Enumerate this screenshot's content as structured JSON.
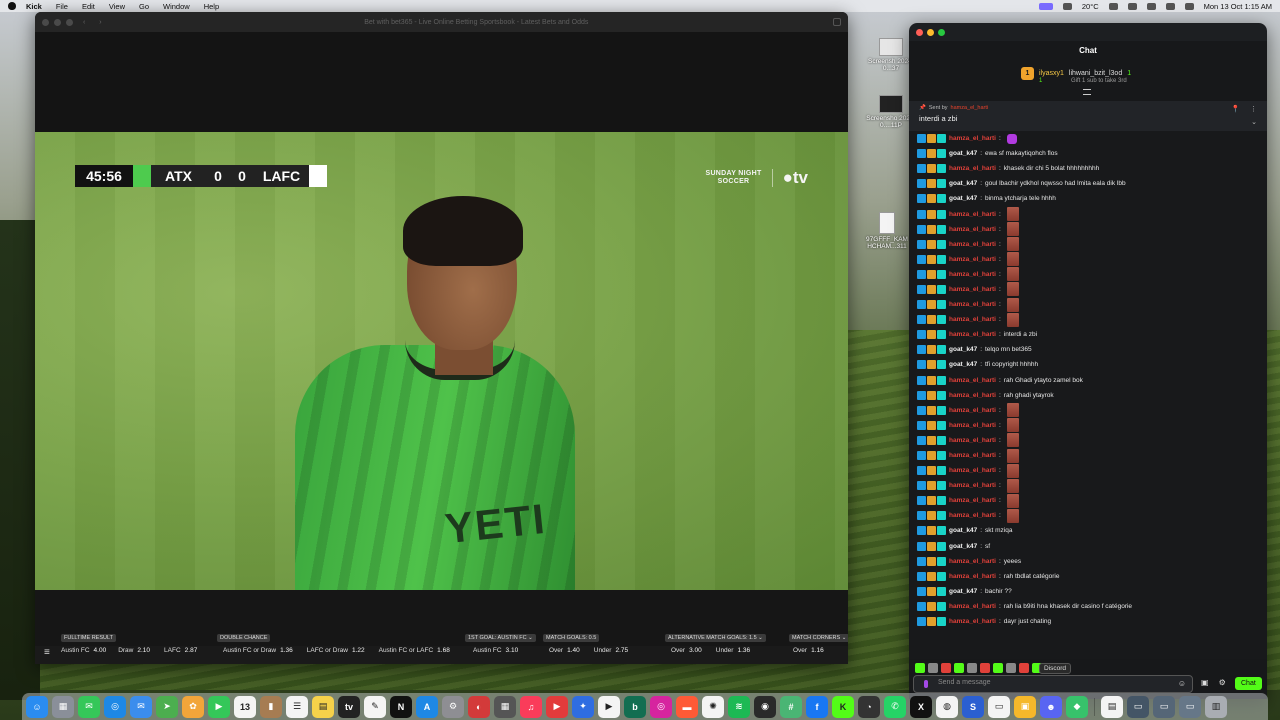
{
  "menubar": {
    "app_name": "Kick",
    "menus": [
      "File",
      "Edit",
      "View",
      "Go",
      "Window",
      "Help"
    ],
    "weather": "20°C",
    "datetime": "Mon 13 Oct 1:15 AM"
  },
  "desktop": {
    "files": [
      {
        "label": "Screensh 2024-0...37"
      },
      {
        "label": "Screensho 2024-0....11P"
      },
      {
        "label": "97GFFF_KAM HCHAM...311"
      }
    ]
  },
  "browser": {
    "title": "Bet with bet365 - Live Online Betting Sportsbook - Latest Bets and Odds",
    "scoreboard": {
      "clock": "45:56",
      "home_team": "ATX",
      "home_score": "0",
      "away_score": "0",
      "away_team": "LAFC"
    },
    "broadcast": {
      "show_line1": "SUNDAY NIGHT",
      "show_line2": "SOCCER",
      "network": "tv"
    },
    "jersey_text": "YETI",
    "bets": [
      {
        "head": "FULLTIME RESULT",
        "items": [
          {
            "label": "Austin FC",
            "odds": "4.00"
          },
          {
            "label": "Draw",
            "odds": "2.10"
          },
          {
            "label": "LAFC",
            "odds": "2.87"
          }
        ]
      },
      {
        "head": "DOUBLE CHANCE",
        "items": [
          {
            "label": "Austin FC or Draw",
            "odds": "1.36"
          },
          {
            "label": "LAFC or Draw",
            "odds": "1.22"
          },
          {
            "label": "Austin FC or LAFC",
            "odds": "1.68"
          }
        ]
      },
      {
        "head": "1ST GOAL: AUSTIN FC ⌄",
        "items": [
          {
            "label": "Austin FC",
            "odds": "3.10"
          }
        ]
      },
      {
        "head": "MATCH GOALS: 0.5",
        "items": [
          {
            "label": "Over",
            "odds": "1.40"
          },
          {
            "label": "Under",
            "odds": "2.75"
          }
        ]
      },
      {
        "head": "ALTERNATIVE MATCH GOALS: 1.5 ⌄",
        "items": [
          {
            "label": "Over",
            "odds": "3.00"
          },
          {
            "label": "Under",
            "odds": "1.36"
          }
        ]
      },
      {
        "head": "MATCH CORNERS ⌄",
        "items": [
          {
            "label": "Over",
            "odds": "1.16"
          }
        ]
      }
    ]
  },
  "chat": {
    "title": "Chat",
    "gift": {
      "badge": "1",
      "user1": "ilyasxy1",
      "count1": "1",
      "user2": "lihwani_bzit_l3od",
      "count2": "1",
      "subtext": "Gift 1 sub to take 3rd"
    },
    "pinned": {
      "sent_by_label": "Sent by",
      "user": "hamza_el_harti",
      "message": "interdi a zbi"
    },
    "messages": [
      {
        "user": "hamza_el_harti",
        "color": "red",
        "text": "",
        "emote": "purple"
      },
      {
        "user": "goat_k47",
        "color": "white",
        "text": "ewa sf makaytiqohch flos",
        "emote": ""
      },
      {
        "user": "hamza_el_harti",
        "color": "red",
        "text": "khasek dir chi 5 bolat hhhhhhhhh",
        "emote": ""
      },
      {
        "user": "goat_k47",
        "color": "white",
        "text": "goul lbachir ydkhol nqwsso had lmita eala dik lbb",
        "emote": ""
      },
      {
        "user": "goat_k47",
        "color": "white",
        "text": "binma ytcharja tele hhhh",
        "emote": ""
      },
      {
        "user": "hamza_el_harti",
        "color": "red",
        "text": "",
        "emote": "img"
      },
      {
        "user": "hamza_el_harti",
        "color": "red",
        "text": "",
        "emote": "img"
      },
      {
        "user": "hamza_el_harti",
        "color": "red",
        "text": "",
        "emote": "img"
      },
      {
        "user": "hamza_el_harti",
        "color": "red",
        "text": "",
        "emote": "img"
      },
      {
        "user": "hamza_el_harti",
        "color": "red",
        "text": "",
        "emote": "img"
      },
      {
        "user": "hamza_el_harti",
        "color": "red",
        "text": "",
        "emote": "img"
      },
      {
        "user": "hamza_el_harti",
        "color": "red",
        "text": "",
        "emote": "img"
      },
      {
        "user": "hamza_el_harti",
        "color": "red",
        "text": "",
        "emote": "img"
      },
      {
        "user": "hamza_el_harti",
        "color": "red",
        "text": "interdi a zbi",
        "emote": ""
      },
      {
        "user": "goat_k47",
        "color": "white",
        "text": "telqo mn bet365",
        "emote": ""
      },
      {
        "user": "goat_k47",
        "color": "white",
        "text": "tfi copyright hhhhh",
        "emote": ""
      },
      {
        "user": "hamza_el_harti",
        "color": "red",
        "text": "rah Ghadi ytayto zamel bok",
        "emote": ""
      },
      {
        "user": "hamza_el_harti",
        "color": "red",
        "text": "rah ghadi ytayrok",
        "emote": ""
      },
      {
        "user": "hamza_el_harti",
        "color": "red",
        "text": "",
        "emote": "img"
      },
      {
        "user": "hamza_el_harti",
        "color": "red",
        "text": "",
        "emote": "img"
      },
      {
        "user": "hamza_el_harti",
        "color": "red",
        "text": "",
        "emote": "img"
      },
      {
        "user": "hamza_el_harti",
        "color": "red",
        "text": "",
        "emote": "img"
      },
      {
        "user": "hamza_el_harti",
        "color": "red",
        "text": "",
        "emote": "img"
      },
      {
        "user": "hamza_el_harti",
        "color": "red",
        "text": "",
        "emote": "img"
      },
      {
        "user": "hamza_el_harti",
        "color": "red",
        "text": "",
        "emote": "img"
      },
      {
        "user": "hamza_el_harti",
        "color": "red",
        "text": "",
        "emote": "img"
      },
      {
        "user": "goat_k47",
        "color": "white",
        "text": "skt mziqa",
        "emote": ""
      },
      {
        "user": "goat_k47",
        "color": "white",
        "text": "sf",
        "emote": ""
      },
      {
        "user": "hamza_el_harti",
        "color": "red",
        "text": "yeees",
        "emote": ""
      },
      {
        "user": "hamza_el_harti",
        "color": "red",
        "text": "rah tbdlat catégorie",
        "emote": ""
      },
      {
        "user": "goat_k47",
        "color": "white",
        "text": "bachir ??",
        "emote": ""
      },
      {
        "user": "hamza_el_harti",
        "color": "red",
        "text": "rah lia b9iti hna khasek dir casino f catégorie",
        "emote": ""
      },
      {
        "user": "hamza_el_harti",
        "color": "red",
        "text": "dayr just chating",
        "emote": ""
      }
    ],
    "input_placeholder": "Send a message",
    "tooltip": "Discord",
    "send_label": "Chat"
  },
  "dock": {
    "apps": [
      {
        "name": "finder-icon",
        "color": "#2a8cf0",
        "glyph": "☺"
      },
      {
        "name": "launchpad-icon",
        "color": "#8a8f99",
        "glyph": "▦"
      },
      {
        "name": "messages-icon",
        "color": "#35c759",
        "glyph": "✉"
      },
      {
        "name": "safari-icon",
        "color": "#1e88e5",
        "glyph": "◎"
      },
      {
        "name": "mail-icon",
        "color": "#3b8ded",
        "glyph": "✉"
      },
      {
        "name": "maps-icon",
        "color": "#4cae4f",
        "glyph": "➤"
      },
      {
        "name": "photos-icon",
        "color": "#f2a53a",
        "glyph": "✿"
      },
      {
        "name": "facetime-icon",
        "color": "#34c759",
        "glyph": "▶"
      },
      {
        "name": "calendar-icon",
        "color": "#f4f4f4",
        "glyph": "13"
      },
      {
        "name": "brown-app-icon",
        "color": "#a67c52",
        "glyph": "▮"
      },
      {
        "name": "reminders-icon",
        "color": "#f4f4f4",
        "glyph": "☰"
      },
      {
        "name": "notes-icon",
        "color": "#f6d24a",
        "glyph": "▤"
      },
      {
        "name": "appletv-icon",
        "color": "#222222",
        "glyph": "tv"
      },
      {
        "name": "freeform-icon",
        "color": "#f4f4f4",
        "glyph": "✎"
      },
      {
        "name": "netflix-icon",
        "color": "#111111",
        "glyph": "N"
      },
      {
        "name": "appstore-icon",
        "color": "#1e88e5",
        "glyph": "A"
      },
      {
        "name": "settings-icon",
        "color": "#8e8e93",
        "glyph": "⚙"
      },
      {
        "name": "app-icon-red",
        "color": "#d33a3a",
        "glyph": "◐"
      },
      {
        "name": "calculator-icon",
        "color": "#555555",
        "glyph": "▦"
      },
      {
        "name": "music-icon",
        "color": "#fa3c5a",
        "glyph": "♫"
      },
      {
        "name": "app-icon-play",
        "color": "#e23b3b",
        "glyph": "▶"
      },
      {
        "name": "messenger-icon",
        "color": "#2f6de1",
        "glyph": "✦"
      },
      {
        "name": "play-icon",
        "color": "#f4f4f4",
        "glyph": "▶"
      },
      {
        "name": "bet365-icon",
        "color": "#126e51",
        "glyph": "b"
      },
      {
        "name": "instagram-icon",
        "color": "#d6249f",
        "glyph": "◎"
      },
      {
        "name": "app-icon-red2",
        "color": "#ff5a36",
        "glyph": "▬"
      },
      {
        "name": "chatgpt-icon",
        "color": "#f4f4f4",
        "glyph": "✺"
      },
      {
        "name": "spotify-icon",
        "color": "#1db954",
        "glyph": "≋"
      },
      {
        "name": "ai-icon",
        "color": "#2a2a2a",
        "glyph": "◉"
      },
      {
        "name": "slack-icon",
        "color": "#4ab574",
        "glyph": "#"
      },
      {
        "name": "facebook-icon",
        "color": "#1877f2",
        "glyph": "f"
      },
      {
        "name": "kick-icon",
        "color": "#53fc18",
        "glyph": "K"
      },
      {
        "name": "activity-icon",
        "color": "#333333",
        "glyph": "◔"
      },
      {
        "name": "whatsapp-icon",
        "color": "#25d366",
        "glyph": "✆"
      },
      {
        "name": "x-icon",
        "color": "#111111",
        "glyph": "X"
      },
      {
        "name": "chrome-icon",
        "color": "#f4f4f4",
        "glyph": "◍"
      },
      {
        "name": "vpn-icon",
        "color": "#2b5fd1",
        "glyph": "S"
      },
      {
        "name": "terminal-icon",
        "color": "#f4f4f4",
        "glyph": "▭"
      },
      {
        "name": "keynote-icon",
        "color": "#f5b82a",
        "glyph": "▣"
      },
      {
        "name": "discord-icon",
        "color": "#5865f2",
        "glyph": "☻"
      },
      {
        "name": "app-icon-green",
        "color": "#37c26b",
        "glyph": "◆"
      }
    ],
    "trailing": [
      {
        "name": "document-icon",
        "color": "#f4f4f4",
        "glyph": "▤"
      },
      {
        "name": "window-thumb-icon",
        "color": "#445566",
        "glyph": "▭"
      },
      {
        "name": "window-thumb-icon-2",
        "color": "#556677",
        "glyph": "▭"
      },
      {
        "name": "window-thumb-icon-3",
        "color": "#667788",
        "glyph": "▭"
      },
      {
        "name": "trash-icon",
        "color": "#a9adb3",
        "glyph": "▥"
      }
    ]
  }
}
